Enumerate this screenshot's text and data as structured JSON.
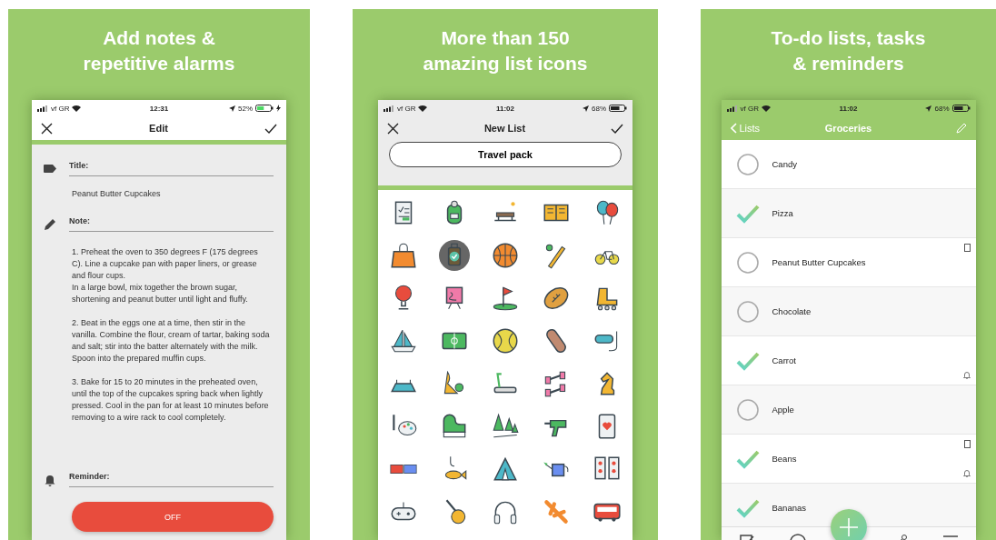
{
  "panels": [
    {
      "kind": "note_editor",
      "headline": "Add notes &\nrepetitive alarms",
      "status": {
        "carrier": "vf GR",
        "time": "12:31",
        "battery": "52%",
        "charging": true
      },
      "title": "Edit",
      "title_label": "Title:",
      "title_value": "Peanut Butter Cupcakes",
      "note_label": "Note:",
      "note_paragraphs": [
        "1. Preheat the oven to 350 degrees F (175 degrees C). Line a cupcake pan with paper liners, or grease and flour cups.\nIn a large bowl, mix together the brown sugar, shortening and peanut butter until light and fluffy.",
        "2. Beat in the eggs one at a time, then stir in the vanilla. Combine the flour, cream of tartar, baking soda and salt; stir into the batter alternately with the milk. Spoon into the prepared muffin cups.",
        "3. Bake for 15 to 20 minutes in the preheated oven, until the top of the cupcakes spring back when lightly pressed. Cool in the pan for at least 10 minutes before removing to a wire rack to cool completely."
      ],
      "reminder_label": "Reminder:",
      "reminder_button": "OFF"
    },
    {
      "kind": "icon_picker",
      "headline": "More than 150\namazing list icons",
      "status": {
        "carrier": "vf GR",
        "time": "11:02",
        "battery": "68%",
        "charging": false
      },
      "title": "New List",
      "name_value": "Travel pack",
      "icons": [
        {
          "selected": false
        },
        {
          "selected": false
        },
        {
          "selected": false
        },
        {
          "selected": false
        },
        {
          "selected": false
        },
        {
          "selected": false
        },
        {
          "selected": true
        },
        {
          "selected": false
        },
        {
          "selected": false
        },
        {
          "selected": false
        },
        {
          "selected": false
        },
        {
          "selected": false
        },
        {
          "selected": false
        },
        {
          "selected": false
        },
        {
          "selected": false
        },
        {
          "selected": false
        },
        {
          "selected": false
        },
        {
          "selected": false
        },
        {
          "selected": false
        },
        {
          "selected": false
        },
        {
          "selected": false
        },
        {
          "selected": false
        },
        {
          "selected": false
        },
        {
          "selected": false
        },
        {
          "selected": false
        },
        {
          "selected": false
        },
        {
          "selected": false
        },
        {
          "selected": false
        },
        {
          "selected": false
        },
        {
          "selected": false
        },
        {
          "selected": false
        },
        {
          "selected": false
        },
        {
          "selected": false
        },
        {
          "selected": false
        },
        {
          "selected": false
        },
        {
          "selected": false
        },
        {
          "selected": false
        },
        {
          "selected": false
        },
        {
          "selected": false
        },
        {
          "selected": false
        }
      ]
    },
    {
      "kind": "todo_list",
      "headline": "To-do lists, tasks\n& reminders",
      "status": {
        "carrier": "vf GR",
        "time": "11:02",
        "battery": "68%",
        "charging": false
      },
      "back": "Lists",
      "title": "Groceries",
      "items": [
        {
          "name": "Candy",
          "checked": false,
          "has_note": false,
          "has_reminder": false
        },
        {
          "name": "Pizza",
          "checked": true,
          "has_note": false,
          "has_reminder": false
        },
        {
          "name": "Peanut Butter Cupcakes",
          "checked": false,
          "has_note": true,
          "has_reminder": false
        },
        {
          "name": "Chocolate",
          "checked": false,
          "has_note": false,
          "has_reminder": false
        },
        {
          "name": "Carrot",
          "checked": true,
          "has_note": false,
          "has_reminder": true
        },
        {
          "name": "Apple",
          "checked": false,
          "has_note": false,
          "has_reminder": false
        },
        {
          "name": "Beans",
          "checked": true,
          "has_note": true,
          "has_reminder": true
        },
        {
          "name": "Bananas",
          "checked": true,
          "has_note": false,
          "has_reminder": false
        }
      ]
    }
  ]
}
